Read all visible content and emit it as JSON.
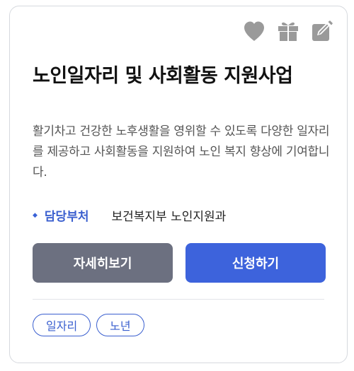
{
  "card": {
    "title": "노인일자리 및 사회활동 지원사업",
    "description": "활기차고 건강한 노후생활을 영위할 수 있도록 다양한 일자리를 제공하고 사회활동을 지원하여 노인 복지 향상에 기여합니다.",
    "department_label": "담당부처",
    "department_value": "보건복지부 노인지원과",
    "detail_button": "자세히보기",
    "apply_button": "신청하기",
    "tags": [
      "일자리",
      "노년"
    ],
    "icons": [
      "heart-icon",
      "gift-icon",
      "edit-icon"
    ]
  },
  "colors": {
    "icon": "#9a9a9a",
    "accent_blue": "#3d63dc",
    "detail_button": "#6c7080",
    "border": "#d6d9de"
  }
}
